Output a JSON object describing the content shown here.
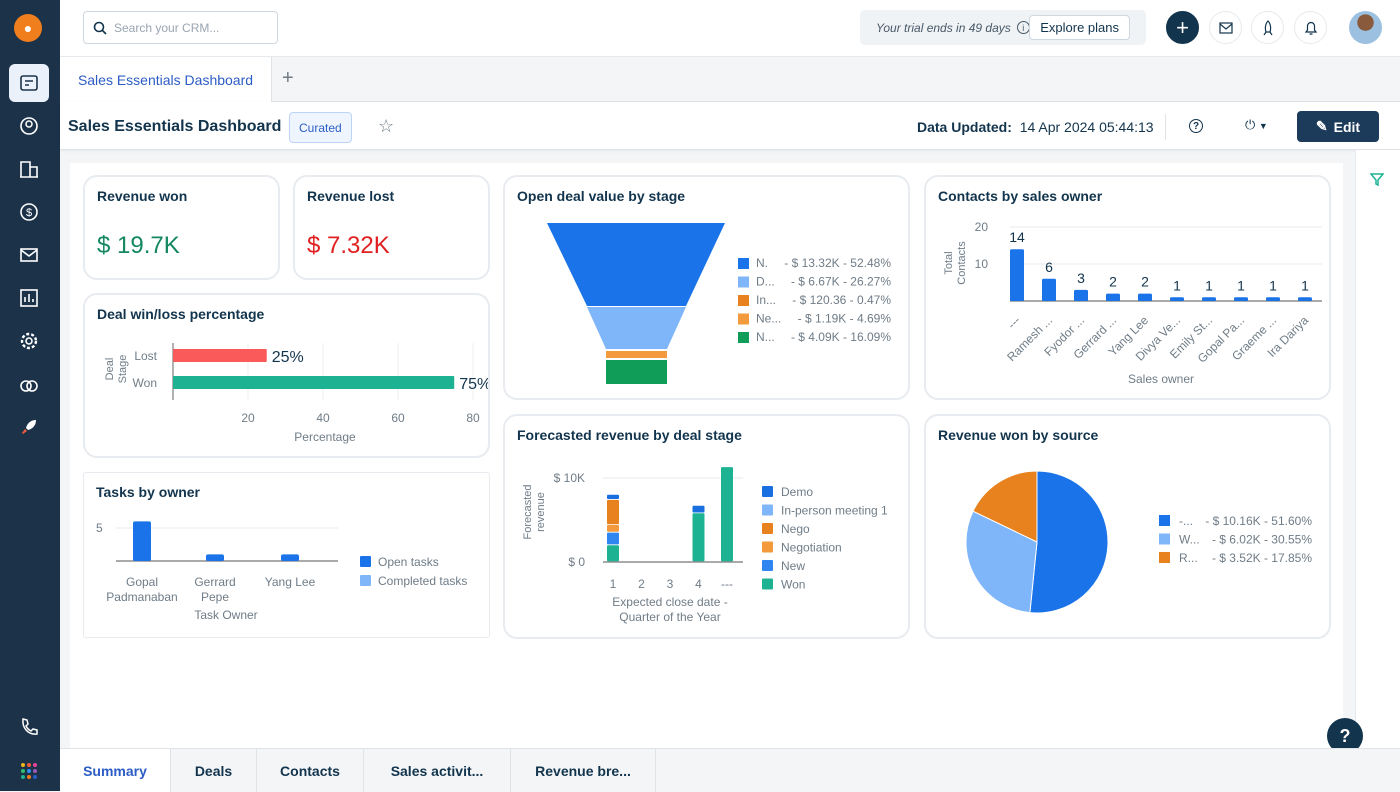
{
  "colors": {
    "sidebar": "#1c3249",
    "accent": "#2c5cc5",
    "won": "#13875f",
    "lost": "#e02020",
    "blue": "#1a73e8",
    "lightblue": "#7fb5f9",
    "orange": "#e8821e",
    "lightorange": "#f39a3c",
    "green": "#0f9d58",
    "teal": "#1db392",
    "red": "#fb5a5a"
  },
  "sidebar": {
    "items": [
      "dashboard-icon",
      "contacts-icon",
      "accounts-icon",
      "deals-icon",
      "email-icon",
      "reports-icon",
      "settings-icon",
      "integrations-icon",
      "rocket-icon"
    ],
    "bottom": [
      "phone-icon",
      "apps-icon"
    ]
  },
  "topbar": {
    "search_placeholder": "Search your CRM...",
    "trial_text": "Your trial ends in 49 days",
    "explore_label": "Explore plans"
  },
  "tabs": {
    "dashboard": "Sales Essentials Dashboard",
    "add": "+"
  },
  "header": {
    "title": "Sales Essentials Dashboard",
    "badge": "Curated",
    "data_updated_label": "Data Updated:",
    "data_updated_value": "14 Apr 2024 05:44:13",
    "edit_label": "Edit"
  },
  "cards": {
    "revenue_won": {
      "title": "Revenue won",
      "value": "$ 19.7K"
    },
    "revenue_lost": {
      "title": "Revenue lost",
      "value": "$ 7.32K"
    },
    "winloss": {
      "title": "Deal win/loss percentage"
    },
    "tasks": {
      "title": "Tasks by owner"
    },
    "funnel": {
      "title": "Open deal value by stage"
    },
    "contacts": {
      "title": "Contacts by sales owner"
    },
    "forecast": {
      "title": "Forecasted revenue by deal stage"
    },
    "source": {
      "title": "Revenue won by source"
    }
  },
  "chart_data": [
    {
      "type": "bar",
      "orientation": "horizontal",
      "categories": [
        "Lost",
        "Won"
      ],
      "values": [
        25,
        75
      ],
      "data_labels": [
        "25%",
        "75%"
      ],
      "xlabel": "Percentage",
      "ylabel": "Deal Stage",
      "xticks": [
        "20",
        "40",
        "60",
        "80"
      ],
      "xlim": [
        0,
        80
      ],
      "grid": true
    },
    {
      "type": "bar",
      "categories": [
        "Gopal Padmanaban",
        "Gerrard Pepe",
        "Yang Lee"
      ],
      "category_lines": [
        [
          "Gopal",
          "Padmanaban"
        ],
        [
          "Gerrard",
          "Pepe"
        ],
        [
          "Yang Lee"
        ]
      ],
      "series": [
        {
          "name": "Open tasks",
          "values": [
            6,
            1,
            1
          ]
        },
        {
          "name": "Completed tasks",
          "values": [
            0,
            0,
            0
          ]
        }
      ],
      "xlabel": "Task Owner",
      "yticks": [
        "5"
      ],
      "legend": "right"
    },
    {
      "type": "funnel",
      "legend": "right",
      "items": [
        {
          "label": "N.",
          "text": "- $ 13.32K - 52.48%",
          "value": 13.32,
          "color": "#1a73e8"
        },
        {
          "label": "D...",
          "text": "- $ 6.67K - 26.27%",
          "value": 6.67,
          "color": "#7fb5f9"
        },
        {
          "label": "In...",
          "text": "- $ 120.36 - 0.47%",
          "value": 0.12,
          "color": "#e8821e"
        },
        {
          "label": "Ne...",
          "text": "- $ 1.19K - 4.69%",
          "value": 1.19,
          "color": "#f39a3c"
        },
        {
          "label": "N...",
          "text": "- $ 4.09K - 16.09%",
          "value": 4.09,
          "color": "#0f9d58"
        }
      ]
    },
    {
      "type": "bar",
      "categories": [
        "---",
        "Ramesh ...",
        "Fyodor ...",
        "Gerrard ...",
        "Yang Lee",
        "Divya Ve...",
        "Emily St...",
        "Gopal Pa...",
        "Graeme ...",
        "Ira Dariya"
      ],
      "values": [
        14,
        6,
        3,
        2,
        2,
        1,
        1,
        1,
        1,
        1
      ],
      "xlabel": "Sales owner",
      "ylabel": "Total Contacts",
      "yticks": [
        "10",
        "20"
      ],
      "ylim": [
        0,
        20
      ],
      "grid": true
    },
    {
      "type": "bar",
      "stacked": true,
      "categories": [
        "1",
        "2",
        "3",
        "4",
        "---"
      ],
      "xlabel": "Expected close date - Quarter of the Year",
      "ylabel": "Forecasted revenue",
      "yticks": [
        "$ 0",
        "$ 10K"
      ],
      "ylim": [
        0,
        10
      ],
      "legend": "right",
      "series": [
        {
          "name": "Demo",
          "color": "#1a6fe0",
          "values": [
            0.6,
            0,
            0,
            0.9,
            0
          ]
        },
        {
          "name": "In-person meeting 1",
          "color": "#7fb5f9",
          "values": [
            0,
            0,
            0,
            0,
            0
          ]
        },
        {
          "name": "Nego",
          "color": "#e8821e",
          "values": [
            3.0,
            0,
            0,
            0,
            0
          ]
        },
        {
          "name": "Negotiation",
          "color": "#f39a3c",
          "values": [
            0.9,
            0,
            0,
            0,
            0
          ]
        },
        {
          "name": "New",
          "color": "#2f86f0",
          "values": [
            1.5,
            0,
            0,
            0,
            0
          ]
        },
        {
          "name": "Won",
          "color": "#1db392",
          "values": [
            2.0,
            0,
            0,
            5.8,
            11.3
          ]
        }
      ]
    },
    {
      "type": "pie",
      "legend": "right",
      "slices": [
        {
          "label": "-...",
          "text": "- $ 10.16K - 51.60%",
          "value": 51.6,
          "color": "#1a73e8"
        },
        {
          "label": "W...",
          "text": "- $ 6.02K - 30.55%",
          "value": 30.55,
          "color": "#7fb5f9"
        },
        {
          "label": "R...",
          "text": "- $ 3.52K - 17.85%",
          "value": 17.85,
          "color": "#e8821e"
        }
      ]
    }
  ],
  "bottom_tabs": [
    "Summary",
    "Deals",
    "Contacts",
    "Sales activit...",
    "Revenue bre..."
  ],
  "help": "?"
}
